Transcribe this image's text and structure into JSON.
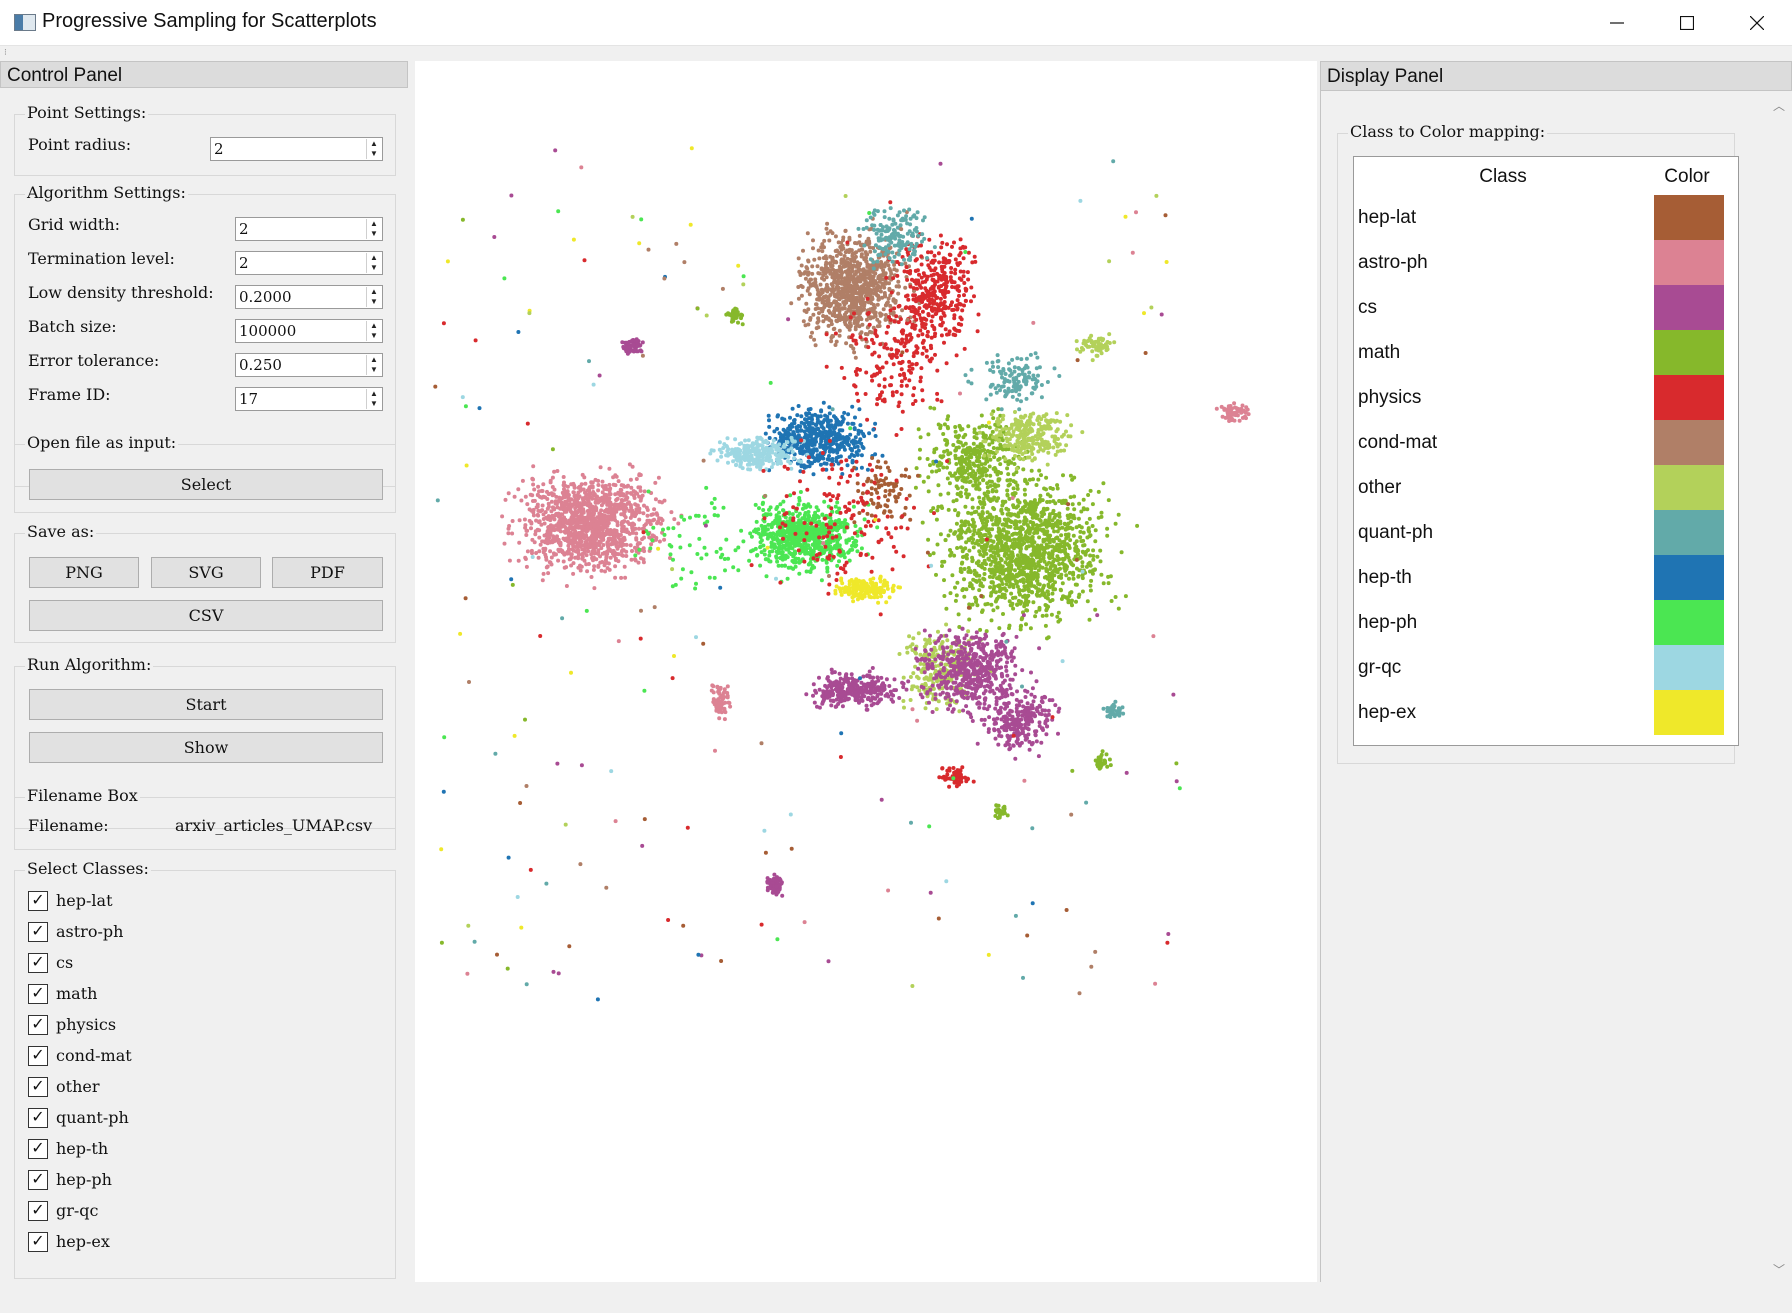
{
  "window": {
    "title": "Progressive Sampling for Scatterplots"
  },
  "control_panel": {
    "header": "Control Panel",
    "point_settings": {
      "title": "Point Settings:",
      "radius_label": "Point radius:",
      "radius_value": "2"
    },
    "algorithm_settings": {
      "title": "Algorithm Settings:",
      "grid_width_label": "Grid width:",
      "grid_width_value": "2",
      "termination_label": "Termination level:",
      "termination_value": "2",
      "low_density_label": "Low density threshold:",
      "low_density_value": "0.2000",
      "batch_size_label": "Batch size:",
      "batch_size_value": "100000",
      "error_tolerance_label": "Error tolerance:",
      "error_tolerance_value": "0.250",
      "frame_id_label": "Frame ID:",
      "frame_id_value": "17"
    },
    "open_file": {
      "title": "Open file as input:",
      "select_label": "Select"
    },
    "save_as": {
      "title": "Save as:",
      "png_label": "PNG",
      "svg_label": "SVG",
      "pdf_label": "PDF",
      "csv_label": "CSV"
    },
    "run_algorithm": {
      "title": "Run Algorithm:",
      "start_label": "Start",
      "show_label": "Show"
    },
    "filename_box": {
      "title": "Filename Box",
      "label": "Filename:",
      "value": "arxiv_articles_UMAP.csv"
    },
    "select_classes": {
      "title": "Select Classes:",
      "classes": [
        {
          "label": "hep-lat",
          "checked": true
        },
        {
          "label": "astro-ph",
          "checked": true
        },
        {
          "label": "cs",
          "checked": true
        },
        {
          "label": "math",
          "checked": true
        },
        {
          "label": "physics",
          "checked": true
        },
        {
          "label": "cond-mat",
          "checked": true
        },
        {
          "label": "other",
          "checked": true
        },
        {
          "label": "quant-ph",
          "checked": true
        },
        {
          "label": "hep-th",
          "checked": true
        },
        {
          "label": "hep-ph",
          "checked": true
        },
        {
          "label": "gr-qc",
          "checked": true
        },
        {
          "label": "hep-ex",
          "checked": true
        }
      ]
    }
  },
  "display_panel": {
    "header": "Display Panel",
    "mapping_title": "Class to Color mapping:",
    "col_class": "Class",
    "col_color": "Color",
    "mapping": [
      {
        "class": "hep-lat",
        "color": "#a65d35"
      },
      {
        "class": "astro-ph",
        "color": "#dc8293"
      },
      {
        "class": "cs",
        "color": "#a84b93"
      },
      {
        "class": "math",
        "color": "#86b82b"
      },
      {
        "class": "physics",
        "color": "#d82a2d"
      },
      {
        "class": "cond-mat",
        "color": "#b07f67"
      },
      {
        "class": "other",
        "color": "#b3d15a"
      },
      {
        "class": "quant-ph",
        "color": "#62aaa9"
      },
      {
        "class": "hep-th",
        "color": "#1f74b3"
      },
      {
        "class": "hep-ph",
        "color": "#4be652"
      },
      {
        "class": "gr-qc",
        "color": "#9dd7e2"
      },
      {
        "class": "hep-ex",
        "color": "#efe82a"
      }
    ]
  }
}
